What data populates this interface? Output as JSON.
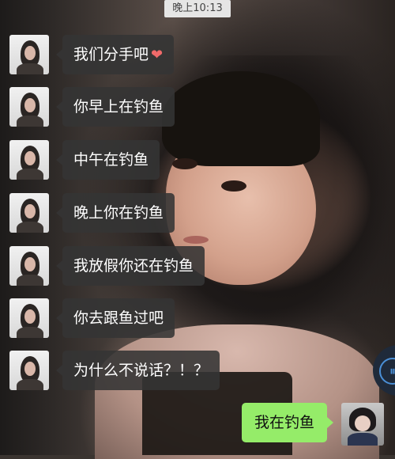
{
  "status": {
    "time": "晚上10:13"
  },
  "messages": [
    {
      "text": "我们分手吧",
      "emoji": "❤"
    },
    {
      "text": "你早上在钓鱼"
    },
    {
      "text": "中午在钓鱼"
    },
    {
      "text": "晚上你在钓鱼"
    },
    {
      "text": "我放假你还在钓鱼"
    },
    {
      "text": "你去跟鱼过吧"
    },
    {
      "text": "为什么不说话？！？"
    }
  ],
  "my_reply": {
    "text": "我在钓鱼"
  },
  "colors": {
    "incoming_bubble": "#343434",
    "outgoing_bubble": "#95ec69",
    "timestamp_bg": "#eeeeee"
  },
  "icons": {
    "contact_avatar": "avatar-icon",
    "my_avatar": "avatar-icon",
    "floating_button": "media-icon"
  }
}
